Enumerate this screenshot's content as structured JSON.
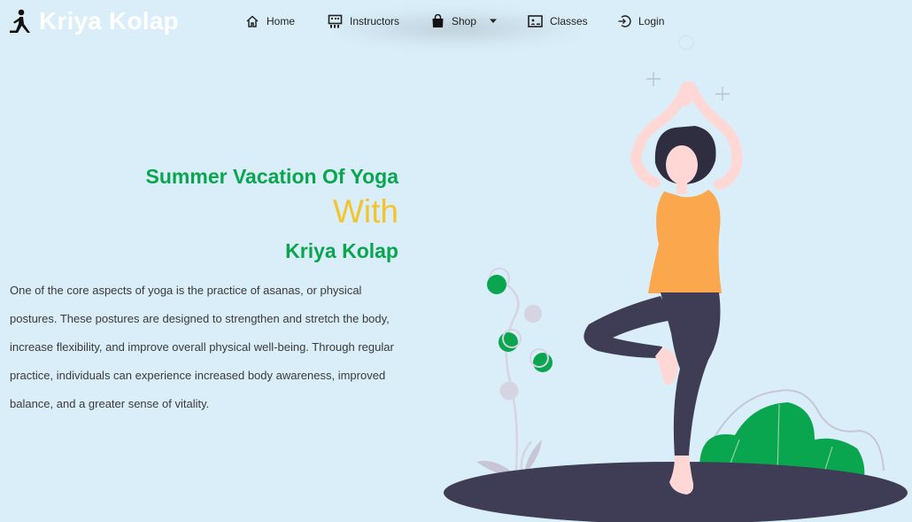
{
  "brand": {
    "name": "Kriya Kolap",
    "icon": "yoga-figure-icon"
  },
  "nav": {
    "items": [
      {
        "label": "Home",
        "icon": "home-icon"
      },
      {
        "label": "Instructors",
        "icon": "chalkboard-icon"
      },
      {
        "label": "Shop",
        "icon": "shopping-bag-icon",
        "dropdown_icon": "caret-down-icon"
      },
      {
        "label": "Classes",
        "icon": "classroom-icon"
      },
      {
        "label": "Login",
        "icon": "login-icon"
      }
    ]
  },
  "hero": {
    "title": "Summer Vacation Of Yoga",
    "with": "With",
    "brand": "Kriya Kolap",
    "body": "One of the core aspects of yoga is the practice of asanas, or physical postures. These postures are designed to strengthen and stretch the body, increase flexibility, and improve overall physical well-being. Through regular practice, individuals can experience increased body awareness, improved balance, and a greater sense of vitality."
  },
  "colors": {
    "background": "#d9eef9",
    "accent_green": "#0aa54f",
    "accent_yellow": "#f3c42c",
    "top_orange": "#fba74e",
    "pants_dark": "#3f3d56",
    "skin": "#ffd8d6"
  }
}
